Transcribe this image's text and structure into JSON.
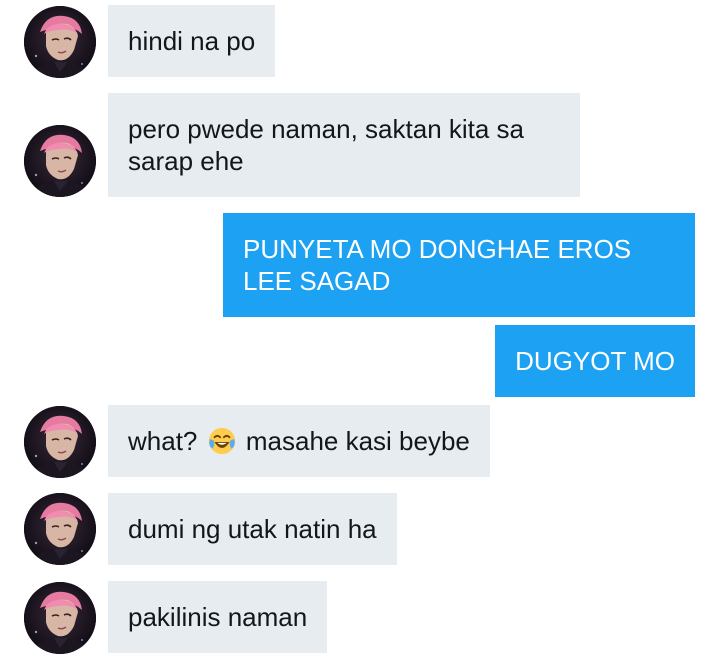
{
  "conversation": {
    "messages": [
      {
        "sender": "other",
        "text": "hindi na po"
      },
      {
        "sender": "other",
        "line1": "pero pwede naman, saktan kita sa",
        "line2": "sarap ehe"
      },
      {
        "sender": "me",
        "line1": "PUNYETA MO DONGHAE EROS",
        "line2": "LEE SAGAD"
      },
      {
        "sender": "me",
        "text": "DUGYOT MO"
      },
      {
        "sender": "other",
        "text_before": "what?",
        "emoji": "face-with-tears-of-joy-icon",
        "text_after": "masahe kasi beybe"
      },
      {
        "sender": "other",
        "text": "dumi ng utak natin ha"
      },
      {
        "sender": "other",
        "text": "pakilinis naman"
      }
    ]
  },
  "colors": {
    "incoming_bubble": "#e6ecf0",
    "incoming_text": "#14171a",
    "outgoing_bubble": "#1da1f2",
    "outgoing_text": "#ffffff"
  },
  "icons": {
    "avatar": "profile-photo"
  }
}
